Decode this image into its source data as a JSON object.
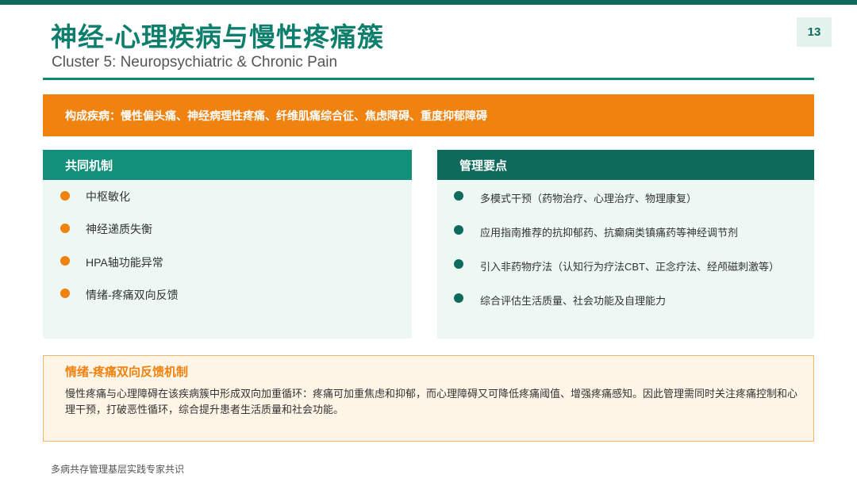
{
  "header": {
    "title": "神经-心理疾病与慢性疼痛簇",
    "subtitle": "Cluster 5: Neuropsychiatric & Chronic Pain",
    "page_number": "13"
  },
  "banner": {
    "text": "构成疾病：慢性偏头痛、神经病理性疼痛、纤维肌痛综合征、焦虑障碍、重度抑郁障碍"
  },
  "mechanism_panel": {
    "title": "共同机制",
    "items": [
      "中枢敏化",
      "神经递质失衡",
      "HPA轴功能异常",
      "情绪-疼痛双向反馈"
    ]
  },
  "management_panel": {
    "title": "管理要点",
    "items": [
      "多模式干预（药物治疗、心理治疗、物理康复）",
      "应用指南推荐的抗抑郁药、抗癫痫类镇痛药等神经调节剂",
      "引入非药物疗法（认知行为疗法CBT、正念疗法、经颅磁刺激等）",
      "综合评估生活质量、社会功能及自理能力"
    ]
  },
  "note": {
    "title": "情绪-疼痛双向反馈机制",
    "body": "慢性疼痛与心理障碍在该疾病簇中形成双向加重循环：疼痛可加重焦虑和抑郁，而心理障碍又可降低疼痛阈值、增强疼痛感知。因此管理需同时关注疼痛控制和心理干预，打破恶性循环，综合提升患者生活质量和社会功能。"
  },
  "footer": {
    "text": "多病共存管理基层实践专家共识"
  },
  "colors": {
    "primary_green": "#0e6b5c",
    "accent_green": "#13907a",
    "accent_orange": "#f08210",
    "note_background": "#fef5e7"
  },
  "icons": {
    "bullet": "filled-circle"
  }
}
